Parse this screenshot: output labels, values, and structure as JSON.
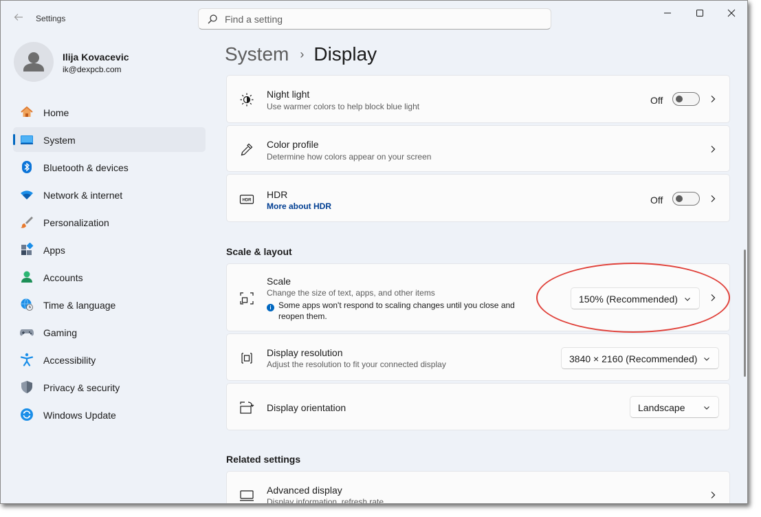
{
  "window": {
    "app_title": "Settings",
    "search_placeholder": "Find a setting"
  },
  "profile": {
    "name": "Ilija Kovacevic",
    "email": "ik@dexpcb.com"
  },
  "sidebar": {
    "items": [
      {
        "label": "Home",
        "icon": "home-icon"
      },
      {
        "label": "System",
        "icon": "system-icon",
        "active": true
      },
      {
        "label": "Bluetooth & devices",
        "icon": "bluetooth-icon"
      },
      {
        "label": "Network & internet",
        "icon": "wifi-icon"
      },
      {
        "label": "Personalization",
        "icon": "brush-icon"
      },
      {
        "label": "Apps",
        "icon": "apps-icon"
      },
      {
        "label": "Accounts",
        "icon": "accounts-icon"
      },
      {
        "label": "Time & language",
        "icon": "globe-clock-icon"
      },
      {
        "label": "Gaming",
        "icon": "gamepad-icon"
      },
      {
        "label": "Accessibility",
        "icon": "accessibility-icon"
      },
      {
        "label": "Privacy & security",
        "icon": "shield-icon"
      },
      {
        "label": "Windows Update",
        "icon": "update-icon"
      }
    ]
  },
  "breadcrumb": {
    "parent": "System",
    "separator": "›",
    "current": "Display"
  },
  "cards": {
    "night_light": {
      "title": "Night light",
      "subtitle": "Use warmer colors to help block blue light",
      "toggle_label": "Off",
      "icon": "night-light-icon"
    },
    "color_profile": {
      "title": "Color profile",
      "subtitle": "Determine how colors appear on your screen",
      "icon": "eyedropper-icon"
    },
    "hdr": {
      "title": "HDR",
      "link": "More about HDR",
      "toggle_label": "Off",
      "icon": "hdr-icon"
    }
  },
  "scale_layout": {
    "heading": "Scale & layout",
    "scale": {
      "title": "Scale",
      "subtitle": "Change the size of text, apps, and other items",
      "warning": "Some apps won't respond to scaling changes until you close and reopen them.",
      "value": "150% (Recommended)",
      "icon": "scale-icon"
    },
    "resolution": {
      "title": "Display resolution",
      "subtitle": "Adjust the resolution to fit your connected display",
      "value": "3840 × 2160 (Recommended)",
      "icon": "resolution-icon"
    },
    "orientation": {
      "title": "Display orientation",
      "value": "Landscape",
      "icon": "orientation-icon"
    }
  },
  "related": {
    "heading": "Related settings",
    "advanced_display": {
      "title": "Advanced display",
      "subtitle": "Display information, refresh rate",
      "icon": "monitor-icon"
    }
  },
  "colors": {
    "accent": "#0067c0",
    "annotation": "#e0413a"
  }
}
